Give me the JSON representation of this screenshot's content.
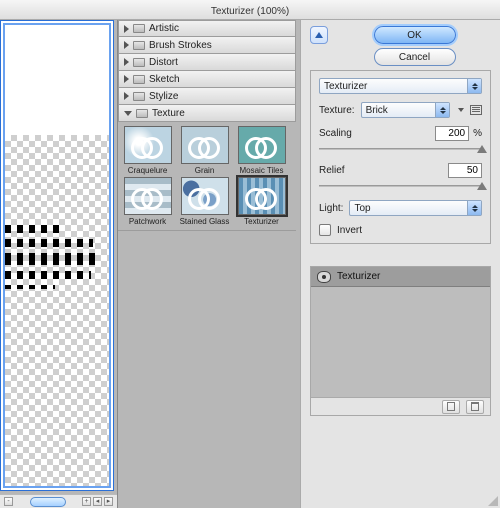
{
  "window": {
    "title": "Texturizer (100%)"
  },
  "preview": {
    "zoom_label": "100%"
  },
  "categories": {
    "items": [
      {
        "label": "Artistic",
        "expanded": false
      },
      {
        "label": "Brush Strokes",
        "expanded": false
      },
      {
        "label": "Distort",
        "expanded": false
      },
      {
        "label": "Sketch",
        "expanded": false
      },
      {
        "label": "Stylize",
        "expanded": false
      },
      {
        "label": "Texture",
        "expanded": true
      }
    ]
  },
  "thumbnails": {
    "items": [
      {
        "label": "Craquelure"
      },
      {
        "label": "Grain"
      },
      {
        "label": "Mosaic Tiles"
      },
      {
        "label": "Patchwork"
      },
      {
        "label": "Stained Glass"
      },
      {
        "label": "Texturizer"
      }
    ],
    "selected": "Texturizer"
  },
  "buttons": {
    "ok": "OK",
    "cancel": "Cancel"
  },
  "settings": {
    "filter_name": "Texturizer",
    "texture_label": "Texture:",
    "texture_value": "Brick",
    "scaling_label": "Scaling",
    "scaling_value": "200",
    "scaling_suffix": "%",
    "relief_label": "Relief",
    "relief_value": "50",
    "light_label": "Light:",
    "light_value": "Top",
    "invert_label": "Invert",
    "invert_checked": false
  },
  "layers": {
    "items": [
      {
        "label": "Texturizer",
        "visible": true
      }
    ]
  }
}
